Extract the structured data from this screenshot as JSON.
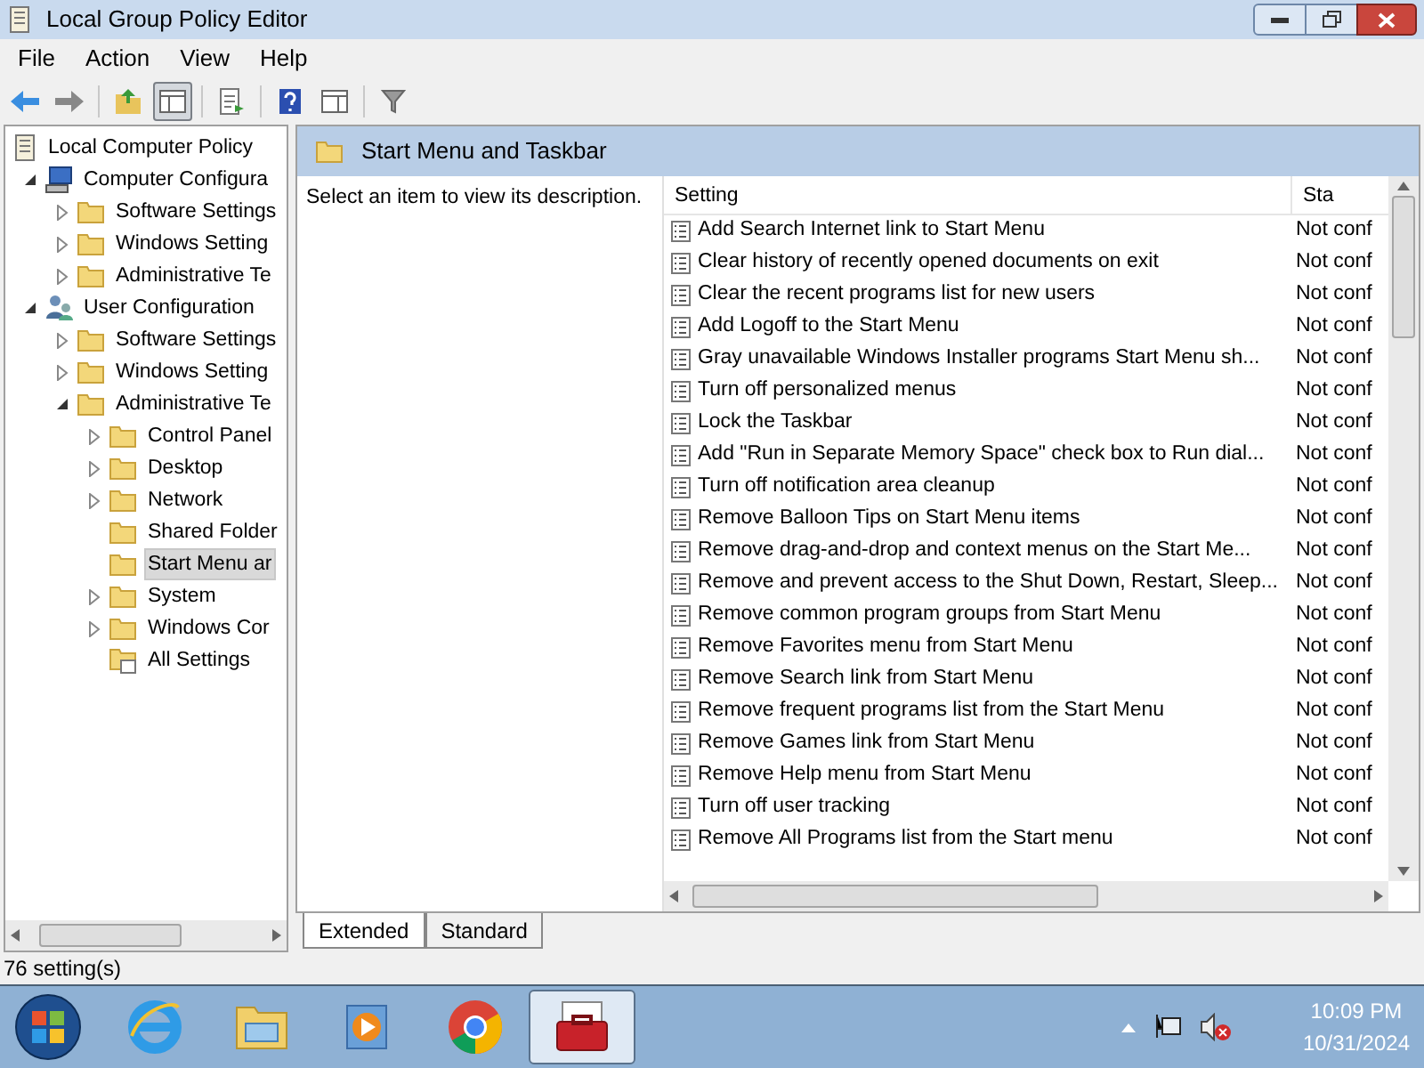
{
  "window": {
    "title": "Local Group Policy Editor"
  },
  "menu": [
    "File",
    "Action",
    "View",
    "Help"
  ],
  "toolbar": [
    {
      "kind": "back",
      "pressed": false
    },
    {
      "kind": "forward",
      "pressed": false
    },
    {
      "kind": "up",
      "pressed": false
    },
    {
      "kind": "console",
      "pressed": true
    },
    {
      "kind": "export",
      "pressed": false
    },
    {
      "kind": "help",
      "pressed": false
    },
    {
      "kind": "pane",
      "pressed": false
    },
    {
      "kind": "filter",
      "pressed": false
    }
  ],
  "tree": [
    {
      "label": "Local Computer Policy",
      "kind": "policy",
      "selected": false,
      "children": [
        {
          "label": "Computer Configura",
          "kind": "computer",
          "expanded": true,
          "selected": false,
          "children": [
            {
              "label": "Software Settings",
              "kind": "folder",
              "expanded": false,
              "selected": false
            },
            {
              "label": "Windows Setting",
              "kind": "folder",
              "expanded": false,
              "selected": false
            },
            {
              "label": "Administrative Te",
              "kind": "folder",
              "expanded": false,
              "selected": false
            }
          ]
        },
        {
          "label": "User Configuration",
          "kind": "user",
          "expanded": true,
          "selected": false,
          "children": [
            {
              "label": "Software Settings",
              "kind": "folder",
              "expanded": false,
              "selected": false
            },
            {
              "label": "Windows Setting",
              "kind": "folder",
              "expanded": false,
              "selected": false
            },
            {
              "label": "Administrative Te",
              "kind": "folder",
              "expanded": true,
              "selected": false,
              "children": [
                {
                  "label": "Control Panel",
                  "kind": "folder",
                  "expanded": false,
                  "selected": false
                },
                {
                  "label": "Desktop",
                  "kind": "folder",
                  "expanded": false,
                  "selected": false
                },
                {
                  "label": "Network",
                  "kind": "folder",
                  "expanded": false,
                  "selected": false
                },
                {
                  "label": "Shared Folder",
                  "kind": "folder",
                  "selected": false
                },
                {
                  "label": "Start Menu ar",
                  "kind": "folder",
                  "selected": true
                },
                {
                  "label": "System",
                  "kind": "folder",
                  "expanded": false,
                  "selected": false
                },
                {
                  "label": "Windows Cor",
                  "kind": "folder",
                  "expanded": false,
                  "selected": false
                },
                {
                  "label": "All Settings",
                  "kind": "settings",
                  "selected": false
                }
              ]
            }
          ]
        }
      ]
    }
  ],
  "header": {
    "title": "Start Menu and Taskbar"
  },
  "description": "Select an item to view its description.",
  "table": {
    "columns": [
      "Setting",
      "Sta"
    ],
    "rows": [
      {
        "setting": "Add Search Internet link to Start Menu",
        "state": "Not conf"
      },
      {
        "setting": "Clear history of recently opened documents on exit",
        "state": "Not conf"
      },
      {
        "setting": "Clear the recent programs list for new users",
        "state": "Not conf"
      },
      {
        "setting": "Add Logoff to the Start Menu",
        "state": "Not conf"
      },
      {
        "setting": "Gray unavailable Windows Installer programs Start Menu sh...",
        "state": "Not conf"
      },
      {
        "setting": "Turn off personalized menus",
        "state": "Not conf"
      },
      {
        "setting": "Lock the Taskbar",
        "state": "Not conf"
      },
      {
        "setting": "Add \"Run in Separate Memory Space\" check box to Run dial...",
        "state": "Not conf"
      },
      {
        "setting": "Turn off notification area cleanup",
        "state": "Not conf"
      },
      {
        "setting": "Remove Balloon Tips on Start Menu items",
        "state": "Not conf"
      },
      {
        "setting": "Remove drag-and-drop and context menus on the Start Me...",
        "state": "Not conf"
      },
      {
        "setting": "Remove and prevent access to the Shut Down, Restart, Sleep...",
        "state": "Not conf"
      },
      {
        "setting": "Remove common program groups from Start Menu",
        "state": "Not conf"
      },
      {
        "setting": "Remove Favorites menu from Start Menu",
        "state": "Not conf"
      },
      {
        "setting": "Remove Search link from Start Menu",
        "state": "Not conf"
      },
      {
        "setting": "Remove frequent programs list from the Start Menu",
        "state": "Not conf"
      },
      {
        "setting": "Remove Games link from Start Menu",
        "state": "Not conf"
      },
      {
        "setting": "Remove Help menu from Start Menu",
        "state": "Not conf"
      },
      {
        "setting": "Turn off user tracking",
        "state": "Not conf"
      },
      {
        "setting": "Remove All Programs list from the Start menu",
        "state": "Not conf"
      }
    ]
  },
  "tabs": [
    {
      "label": "Extended",
      "selected": true
    },
    {
      "label": "Standard",
      "selected": false
    }
  ],
  "status_bar": "76 setting(s)",
  "taskbar": {
    "apps": [
      {
        "kind": "browser-e",
        "selected": false
      },
      {
        "kind": "folders",
        "selected": false
      },
      {
        "kind": "player",
        "selected": false
      },
      {
        "kind": "chrome",
        "selected": false
      },
      {
        "kind": "toolbox",
        "selected": true
      }
    ],
    "clock": {
      "time": "10:09 PM",
      "date": "10/31/2024"
    }
  }
}
